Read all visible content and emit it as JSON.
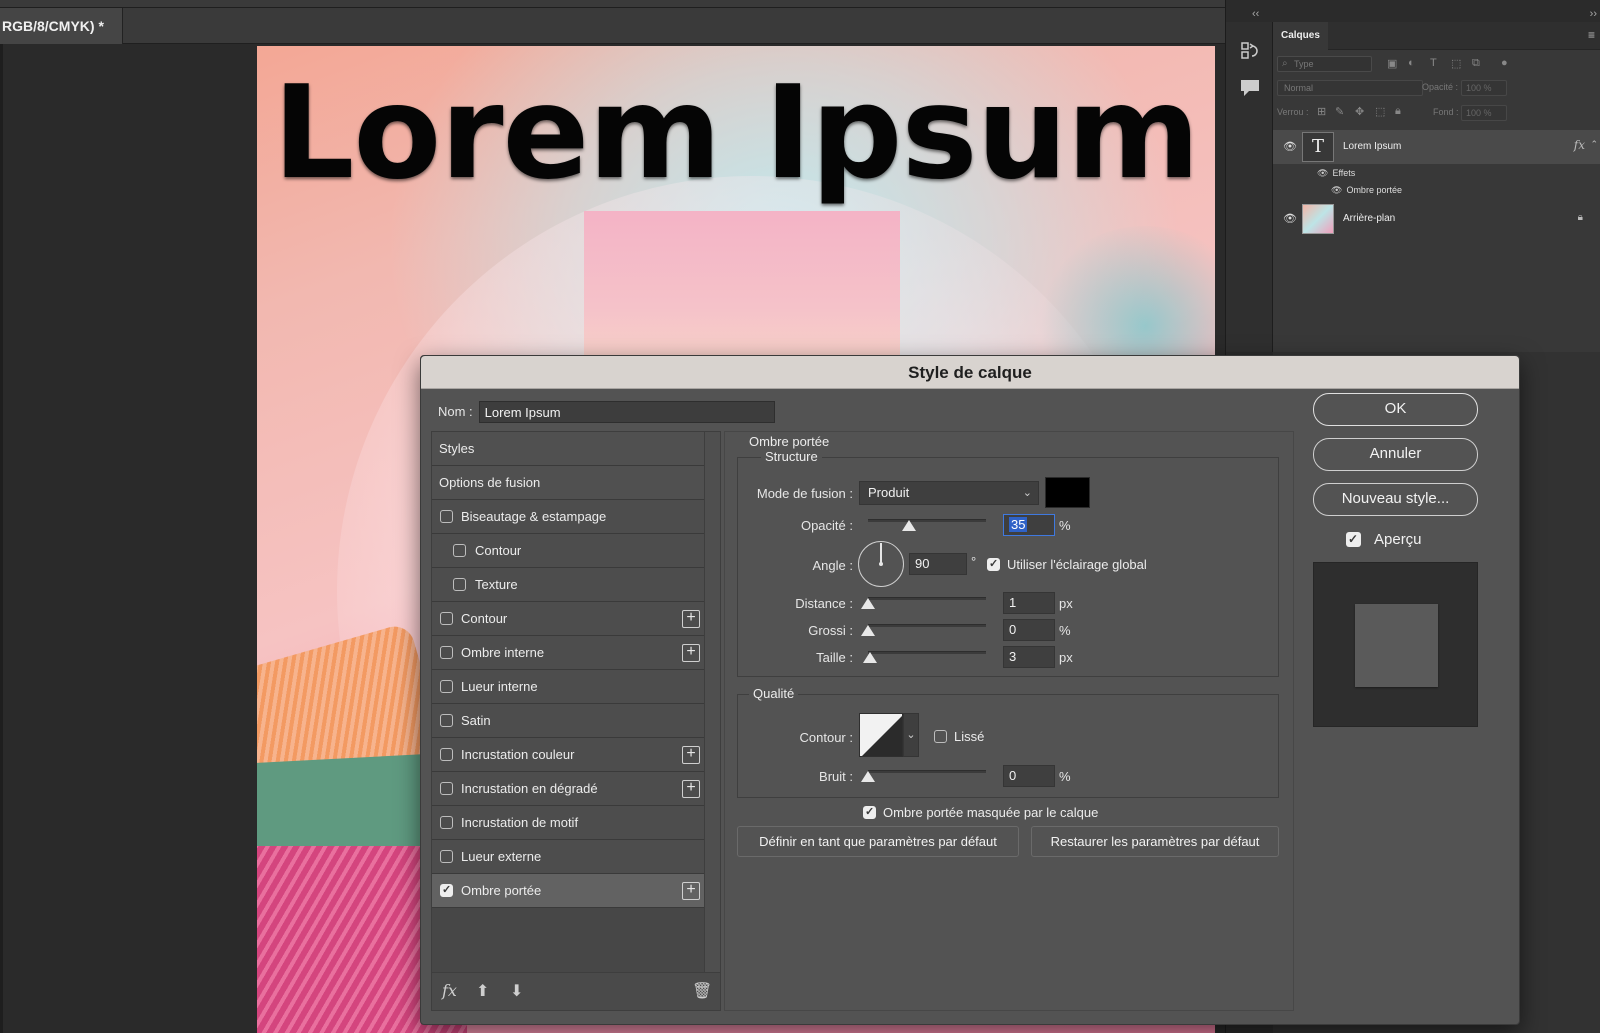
{
  "document": {
    "tab_title": "RGB/8/CMYK) *"
  },
  "artwork": {
    "headline": "Lorem Ipsum"
  },
  "layers_panel": {
    "collapse_left": "‹‹",
    "collapse_right": "››",
    "tab_label": "Calques",
    "search_placeholder": "Type",
    "blend_mode": "Normal",
    "opacity_label": "Opacité :",
    "opacity_value": "100 %",
    "lock_label": "Verrou :",
    "fill_label": "Fond :",
    "fill_value": "100 %",
    "layers": [
      {
        "name": "Lorem Ipsum",
        "thumb": "T",
        "fx": "fx"
      },
      {
        "name": "Arrière-plan"
      }
    ],
    "effects_label": "Effets",
    "effect_item": "Ombre portée"
  },
  "dialog": {
    "title": "Style de calque",
    "name_label": "Nom :",
    "name_value": "Lorem Ipsum",
    "styles": [
      {
        "label": "Styles",
        "type": "header"
      },
      {
        "label": "Options de fusion",
        "type": "header"
      },
      {
        "label": "Biseautage & estampage",
        "type": "check",
        "checked": false
      },
      {
        "label": "Contour",
        "type": "sub",
        "checked": false
      },
      {
        "label": "Texture",
        "type": "sub",
        "checked": false
      },
      {
        "label": "Contour",
        "type": "check",
        "checked": false,
        "plus": true
      },
      {
        "label": "Ombre interne",
        "type": "check",
        "checked": false,
        "plus": true
      },
      {
        "label": "Lueur interne",
        "type": "check",
        "checked": false
      },
      {
        "label": "Satin",
        "type": "check",
        "checked": false
      },
      {
        "label": "Incrustation couleur",
        "type": "check",
        "checked": false,
        "plus": true
      },
      {
        "label": "Incrustation en dégradé",
        "type": "check",
        "checked": false,
        "plus": true
      },
      {
        "label": "Incrustation de motif",
        "type": "check",
        "checked": false
      },
      {
        "label": "Lueur externe",
        "type": "check",
        "checked": false
      },
      {
        "label": "Ombre portée",
        "type": "check",
        "checked": true,
        "plus": true,
        "selected": true
      }
    ],
    "section_title": "Ombre portée",
    "structure": {
      "title": "Structure",
      "blend_label": "Mode de fusion :",
      "blend_value": "Produit",
      "shadow_color": "#000000",
      "opacity_label": "Opacité :",
      "opacity_value": "35",
      "opacity_unit": "%",
      "opacity_fraction": 0.35,
      "angle_label": "Angle :",
      "angle_value": "90",
      "angle_unit": "°",
      "global_light_label": "Utiliser l'éclairage global",
      "global_light_checked": true,
      "distance_label": "Distance :",
      "distance_value": "1",
      "distance_unit": "px",
      "spread_label": "Grossi :",
      "spread_value": "0",
      "spread_unit": "%",
      "size_label": "Taille :",
      "size_value": "3",
      "size_unit": "px"
    },
    "quality": {
      "title": "Qualité",
      "contour_label": "Contour :",
      "antialias_label": "Lissé",
      "antialias_checked": false,
      "noise_label": "Bruit :",
      "noise_value": "0",
      "noise_unit": "%"
    },
    "knockout_label": "Ombre portée masquée par le calque",
    "knockout_checked": true,
    "set_default_label": "Définir en tant que paramètres par défaut",
    "reset_default_label": "Restaurer les paramètres par défaut",
    "ok_label": "OK",
    "cancel_label": "Annuler",
    "new_style_label": "Nouveau style...",
    "preview_label": "Aperçu",
    "preview_checked": true,
    "footer_fx": "fx"
  }
}
